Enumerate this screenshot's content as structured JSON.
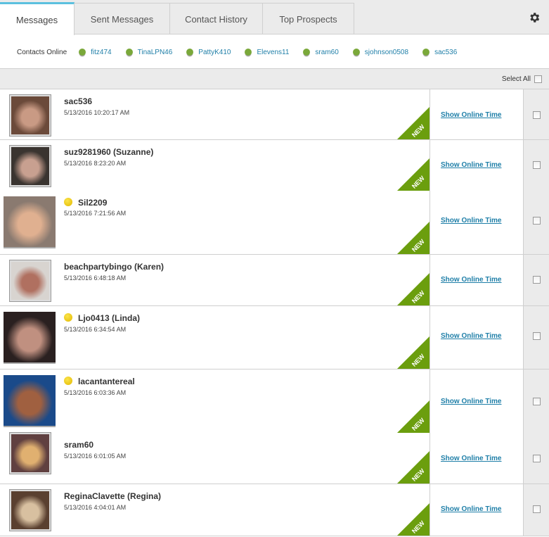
{
  "tabs": [
    {
      "label": "Messages",
      "active": true
    },
    {
      "label": "Sent Messages",
      "active": false
    },
    {
      "label": "Contact History",
      "active": false
    },
    {
      "label": "Top Prospects",
      "active": false
    }
  ],
  "settings_icon": "gear-icon",
  "contacts_online": {
    "label": "Contacts Online",
    "contacts": [
      "fitz474",
      "TinaLPN46",
      "PattyK410",
      "Elevens11",
      "sram60",
      "sjohnson0508",
      "sac536"
    ]
  },
  "select_all_label": "Select All",
  "new_badge": "NEW",
  "link_label": "Show Online Time",
  "colors": {
    "accent": "#5bc0de",
    "online": "#7aa83a",
    "new_badge": "#6b9e0e",
    "link": "#1f7fa8",
    "away": "#f0c419"
  },
  "messages": [
    {
      "name": "sac536",
      "date": "5/13/2016 10:20:17 AM",
      "away": false,
      "new": true
    },
    {
      "name": "suz9281960 (Suzanne)",
      "date": "5/13/2016 8:23:20 AM",
      "away": false,
      "new": true
    },
    {
      "name": "Sil2209",
      "date": "5/13/2016 7:21:56 AM",
      "away": true,
      "new": true
    },
    {
      "name": "beachpartybingo (Karen)",
      "date": "5/13/2016 6:48:18 AM",
      "away": false,
      "new": true
    },
    {
      "name": "Ljo0413 (Linda)",
      "date": "5/13/2016 6:34:54 AM",
      "away": true,
      "new": true
    },
    {
      "name": "lacantantereal",
      "date": "5/13/2016 6:03:36 AM",
      "away": true,
      "new": true
    },
    {
      "name": "sram60",
      "date": "5/13/2016 6:01:05 AM",
      "away": false,
      "new": true
    },
    {
      "name": "ReginaClavette (Regina)",
      "date": "5/13/2016 4:04:01 AM",
      "away": false,
      "new": true
    }
  ]
}
